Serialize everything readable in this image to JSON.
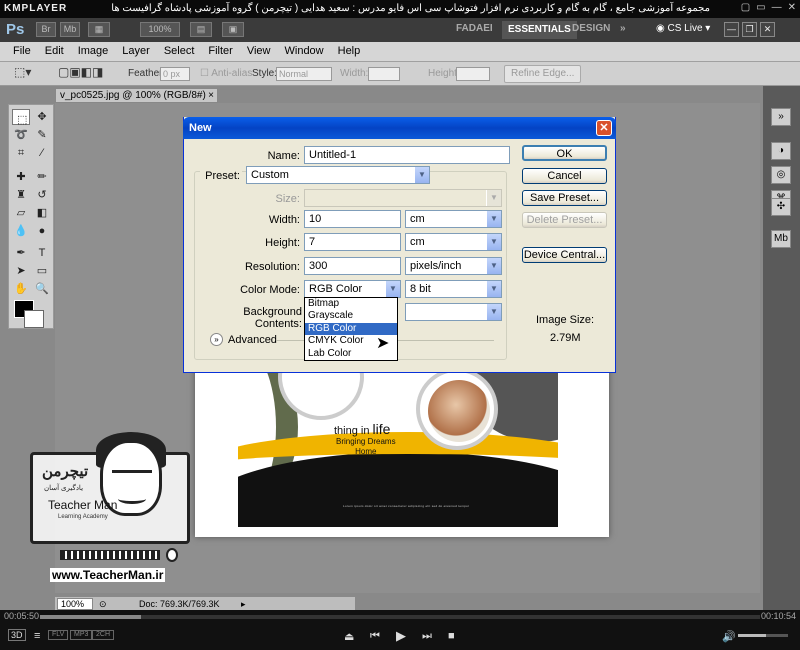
{
  "kmplayer": {
    "logo": "KMPLAYER",
    "title": "مجموعه آموزشی جامع ، گام به گام و کاربردی نرم افزار فتوشاپ سی اس فایو   مدرس : سعید هدایی ( تیچرمن ) گروه آموزشی پادشاه گرافیست ها",
    "window_buttons": [
      "▢",
      "▭",
      "—",
      "✕"
    ],
    "time_elapsed": "00:05:50",
    "time_total": "00:10:54",
    "badges": [
      "3D",
      "FLV",
      "MP3",
      "2CH"
    ],
    "progress": 0.14,
    "volume": 0.55
  },
  "ps": {
    "logo": "Ps",
    "app_buttons": [
      "Br",
      "Mb"
    ],
    "zoom_box": "100%",
    "workspaces": [
      "FADAEI",
      "ESSENTIALS",
      "DESIGN"
    ],
    "active_workspace": "ESSENTIALS",
    "more": "»",
    "cs_live": "CS Live",
    "window_controls": [
      "—",
      "❐",
      "✕"
    ]
  },
  "menu": [
    "File",
    "Edit",
    "Image",
    "Layer",
    "Select",
    "Filter",
    "View",
    "Window",
    "Help"
  ],
  "options": {
    "feather_label": "Feather:",
    "feather_value": "0 px",
    "antialias": "Anti-alias",
    "style_label": "Style:",
    "style_value": "Normal",
    "width_label": "Width:",
    "height_label": "Height:",
    "refine_edge": "Refine Edge..."
  },
  "document": {
    "tab_title": "v_pc0525.jpg @ 100% (RGB/8#)",
    "close": "×",
    "zoom": "100%",
    "doc_info": "Doc: 769.3K/769.3K"
  },
  "artwork": {
    "line1a": "thing in ",
    "line1b": "life",
    "line2": "Bringing Dreams",
    "line3": "Home",
    "fine": "Lorem ipsum dolor sit amet consectetur adipiscing elit sed do eiusmod tempor"
  },
  "watermark": {
    "logo_fa": "تیچرمن",
    "subtitle_fa": "یادگیری آسان",
    "name": "Teacher Man",
    "tagline": "Learning Academy",
    "url": "www.TeacherMan.ir"
  },
  "dialog": {
    "title": "New",
    "name_label": "Name:",
    "name_value": "Untitled-1",
    "preset_label": "Preset:",
    "preset_value": "Custom",
    "size_label": "Size:",
    "size_value": "",
    "width_label": "Width:",
    "width_value": "10",
    "width_unit": "cm",
    "height_label": "Height:",
    "height_value": "7",
    "height_unit": "cm",
    "resolution_label": "Resolution:",
    "resolution_value": "300",
    "resolution_unit": "pixels/inch",
    "colormode_label": "Color Mode:",
    "colormode_value": "RGB Color",
    "bitdepth_value": "8 bit",
    "bgcontents_label": "Background Contents:",
    "advanced_label": "Advanced",
    "image_size_label": "Image Size:",
    "image_size_value": "2.79M",
    "buttons": {
      "ok": "OK",
      "cancel": "Cancel",
      "save_preset": "Save Preset...",
      "delete_preset": "Delete Preset...",
      "device_central": "Device Central..."
    },
    "colormode_options": [
      "Bitmap",
      "Grayscale",
      "RGB Color",
      "CMYK Color",
      "Lab Color"
    ],
    "colormode_highlighted": "RGB Color"
  },
  "colors": {
    "xp_title_blue": "#0443c4",
    "highlight": "#316ac5",
    "yellow": "#f0b400",
    "olive": "#616b4c"
  }
}
